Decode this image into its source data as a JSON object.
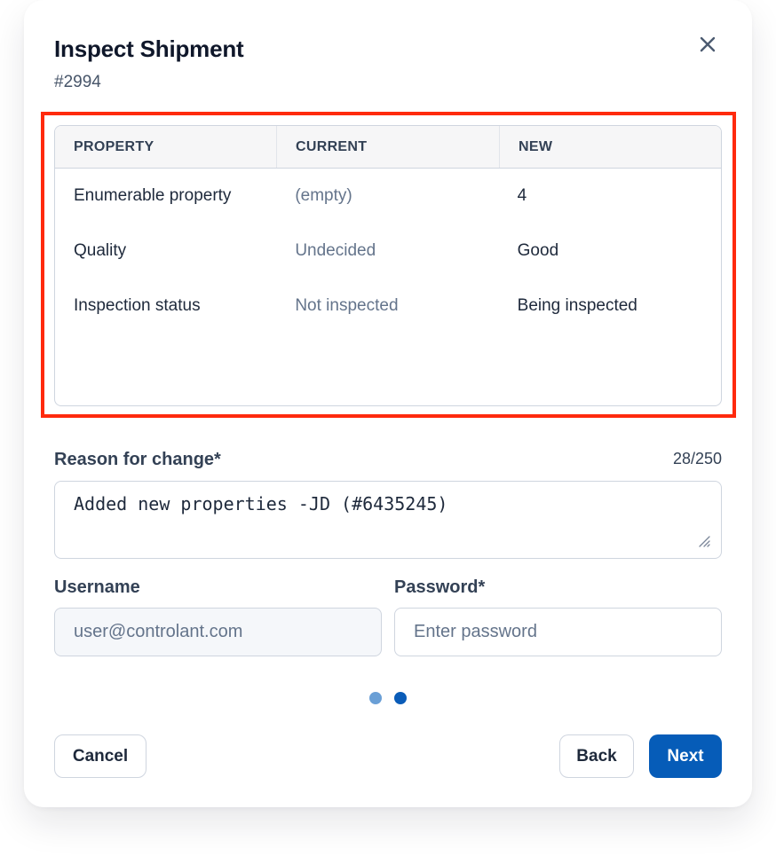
{
  "dialog": {
    "title": "Inspect Shipment",
    "subtitle": "#2994",
    "close_icon": "close-icon"
  },
  "table": {
    "columns": [
      "PROPERTY",
      "CURRENT",
      "NEW"
    ],
    "rows": [
      {
        "property": "Enumerable property",
        "current": "(empty)",
        "new": "4"
      },
      {
        "property": "Quality",
        "current": "Undecided",
        "new": "Good"
      },
      {
        "property": "Inspection status",
        "current": "Not inspected",
        "new": "Being inspected"
      }
    ],
    "highlight_color": "#ff2a0d"
  },
  "reason": {
    "label": "Reason for change*",
    "counter": "28/250",
    "value": "Added new properties -JD (#6435245)"
  },
  "username": {
    "label": "Username",
    "value": "user@controlant.com"
  },
  "password": {
    "label": "Password*",
    "placeholder": "Enter password",
    "value": ""
  },
  "stepper": {
    "total_steps": 2,
    "current_step": 2
  },
  "buttons": {
    "cancel": "Cancel",
    "back": "Back",
    "next": "Next"
  },
  "colors": {
    "primary": "#065cb8",
    "step_inactive": "#6a9fd6",
    "step_active": "#0a5cb8"
  }
}
